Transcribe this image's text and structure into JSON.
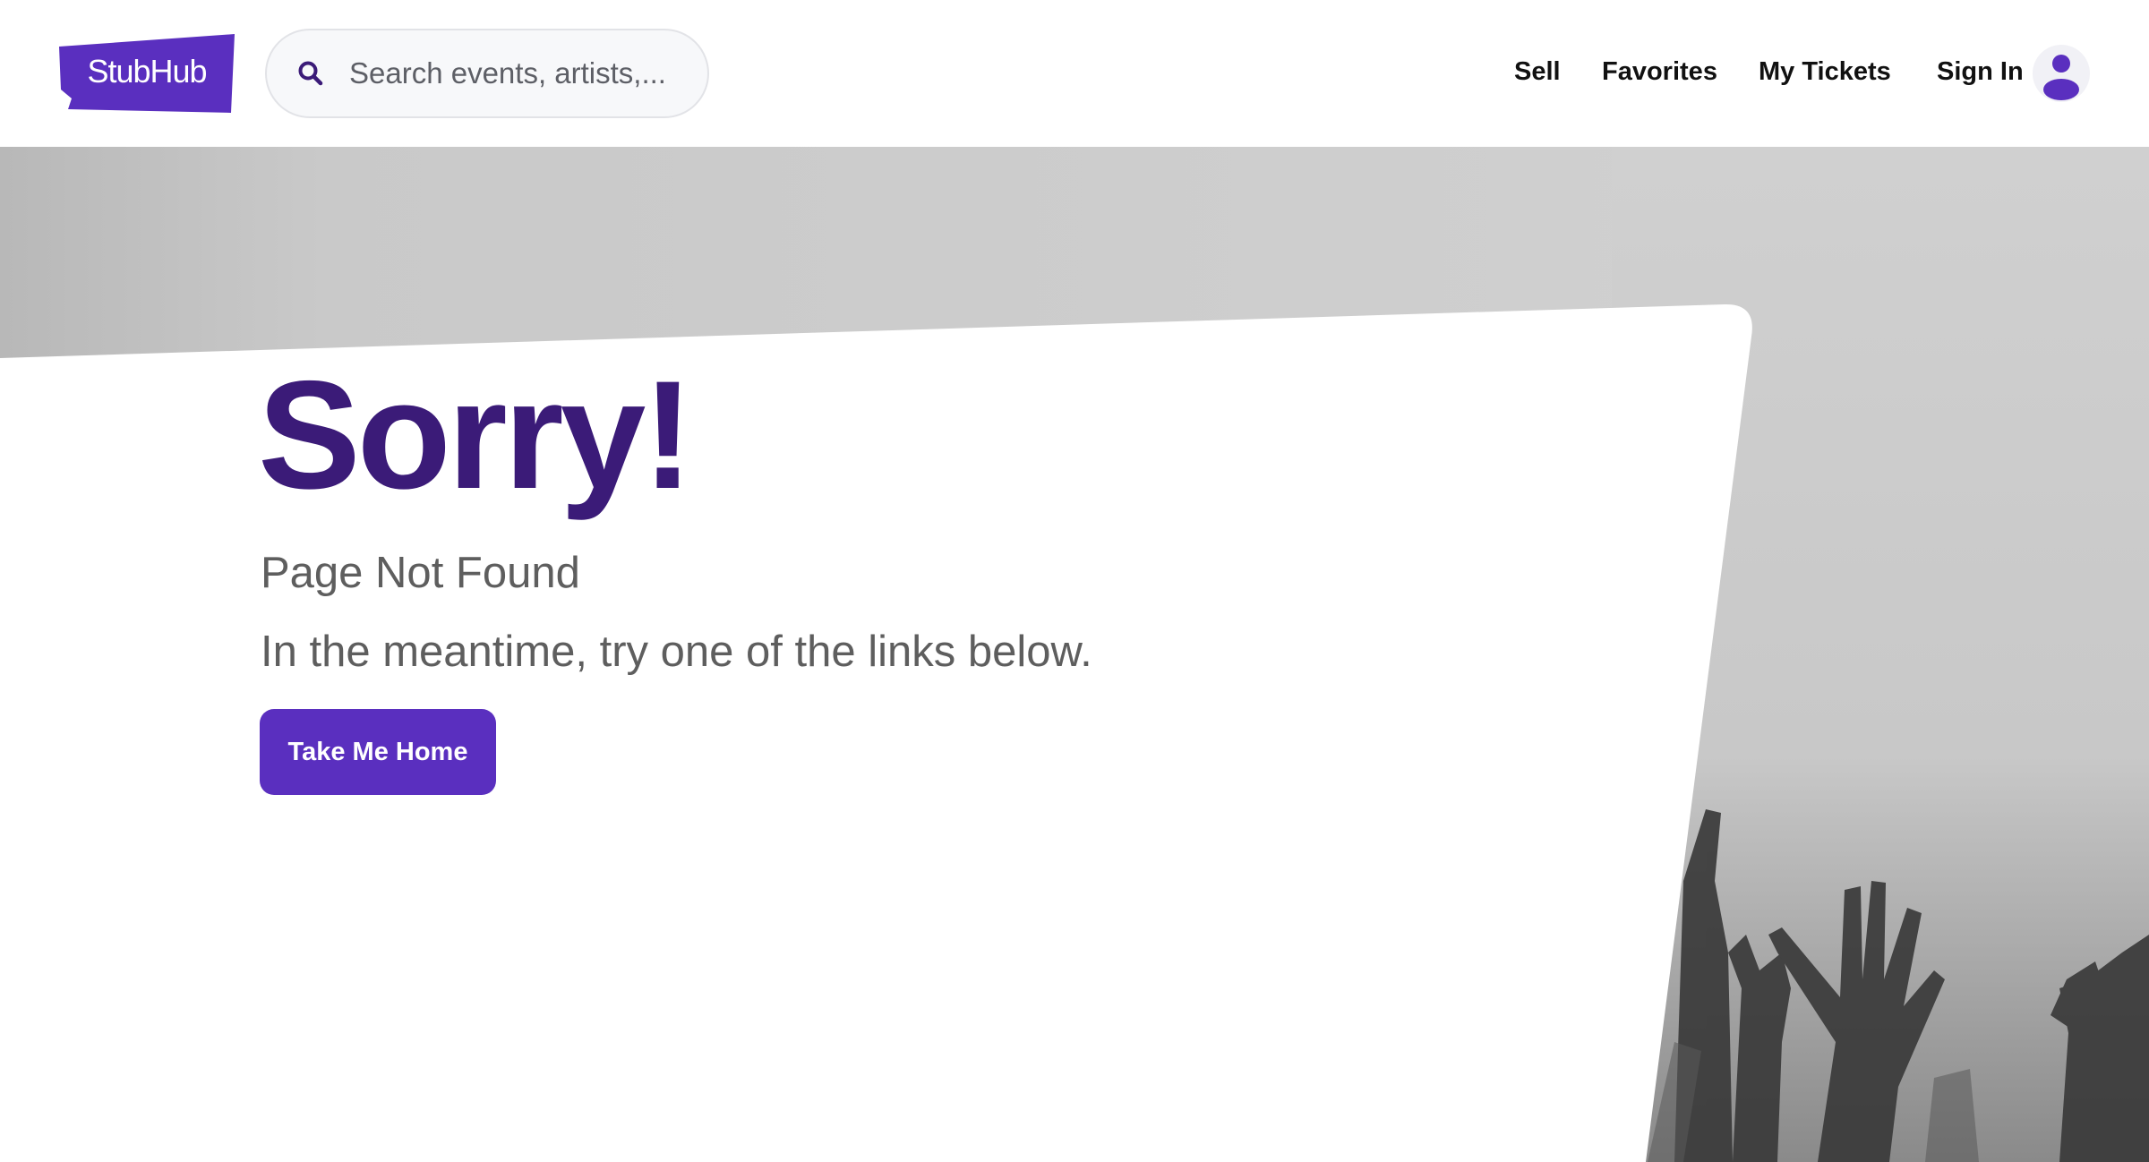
{
  "header": {
    "logo_text": "StubHub",
    "search": {
      "placeholder": "Search events, artists,..."
    },
    "nav": {
      "sell": "Sell",
      "favorites": "Favorites",
      "my_tickets": "My Tickets",
      "sign_in": "Sign In"
    }
  },
  "error": {
    "title": "Sorry!",
    "subtitle": "Page Not Found",
    "message": "In the meantime, try one of the links below.",
    "home_button": "Take Me Home"
  },
  "icons": {
    "search": "search-icon",
    "user": "user-icon"
  },
  "colors": {
    "brand": "#5a2fbf",
    "title": "#3b1b78",
    "text": "#5e5e5e"
  }
}
